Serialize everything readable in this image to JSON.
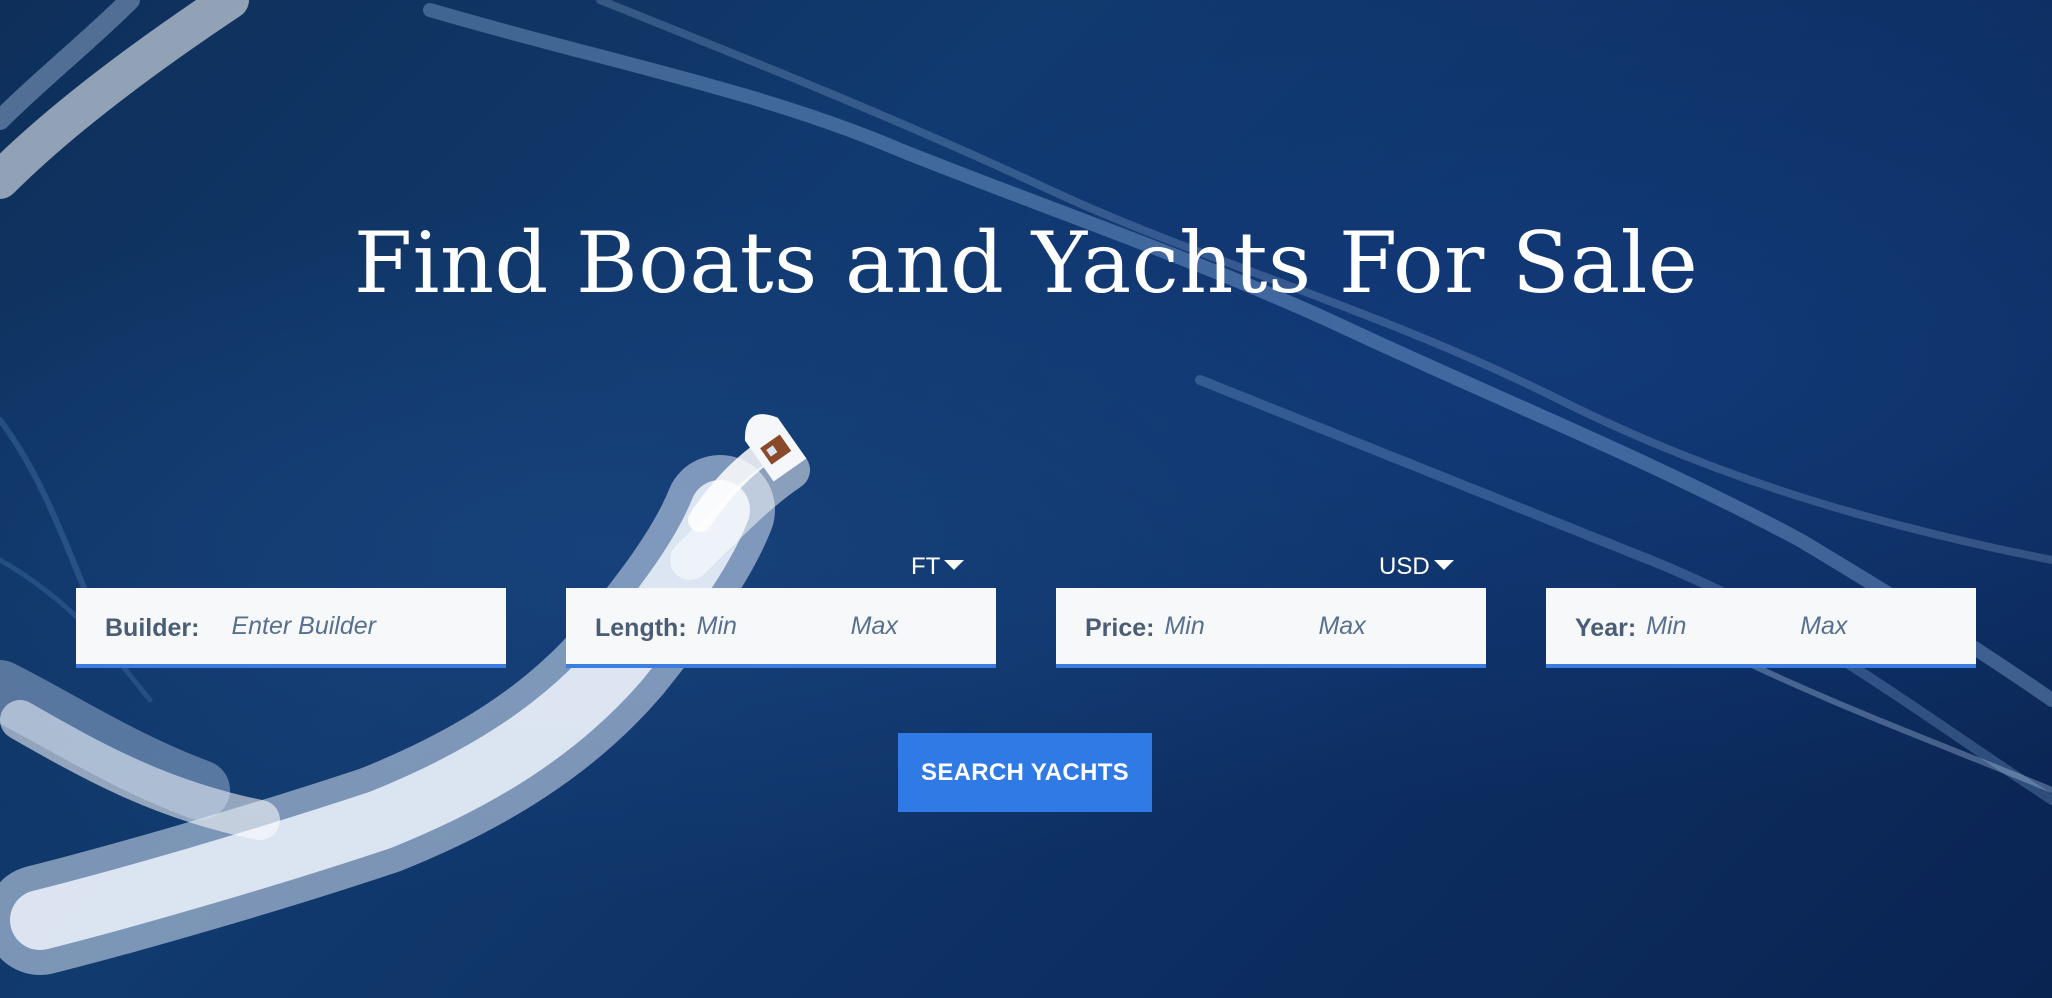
{
  "hero": {
    "title": "Find Boats and Yachts For Sale"
  },
  "search": {
    "builder": {
      "label": "Builder:",
      "placeholder": "Enter Builder"
    },
    "length": {
      "label": "Length:",
      "min_placeholder": "Min",
      "max_placeholder": "Max",
      "unit": "FT"
    },
    "price": {
      "label": "Price:",
      "min_placeholder": "Min",
      "max_placeholder": "Max",
      "currency": "USD"
    },
    "year": {
      "label": "Year:",
      "min_placeholder": "Min",
      "max_placeholder": "Max"
    },
    "submit_label": "SEARCH YACHTS"
  },
  "icons": {
    "dropdown": "caret-down-icon"
  },
  "colors": {
    "accent": "#2f7ae5",
    "field_underline": "#3b7de0",
    "field_background": "#f7f8fa",
    "field_text": "#4a5d75",
    "ocean": "#0e2f5a"
  }
}
